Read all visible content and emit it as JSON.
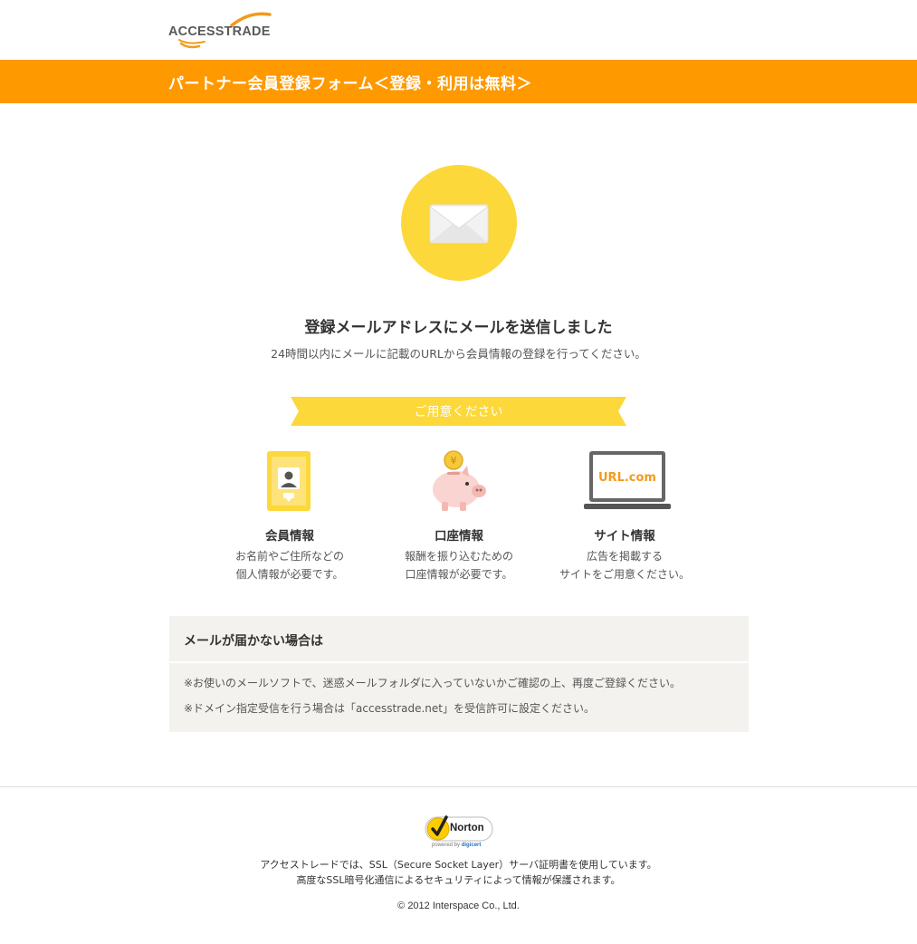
{
  "header": {
    "logo_text": "ACCESSTRADE",
    "banner_title": "パートナー会員登録フォーム＜登録・利用は無料＞"
  },
  "main": {
    "icon": "envelope-icon",
    "headline": "登録メールアドレスにメールを送信しました",
    "subline": "24時間以内にメールに記載のURLから会員情報の登録を行ってください。",
    "ribbon_label": "ご用意ください",
    "features": [
      {
        "icon": "id-card-icon",
        "title": "会員情報",
        "desc1": "お名前やご住所などの",
        "desc2": "個人情報が必要です。"
      },
      {
        "icon": "piggy-bank-icon",
        "title": "口座情報",
        "desc1": "報酬を振り込むための",
        "desc2": "口座情報が必要です。"
      },
      {
        "icon": "laptop-url-icon",
        "title": "サイト情報",
        "desc1": "広告を掲載する",
        "desc2": "サイトをご用意ください。",
        "screen_text": "URL.com"
      }
    ]
  },
  "notice": {
    "title": "メールが届かない場合は",
    "lines": [
      "※お使いのメールソフトで、迷惑メールフォルダに入っていないかご確認の上、再度ご登録ください。",
      "※ドメイン指定受信を行う場合は「accesstrade.net」を受信許可に設定ください。"
    ]
  },
  "footer": {
    "norton_label": "Norton",
    "norton_sub_prefix": "powered by",
    "norton_sub_brand": "digicert",
    "ssl_line1": "アクセストレードでは、SSL（Secure Socket Layer）サーバ証明書を使用しています。",
    "ssl_line2": "高度なSSL暗号化通信によるセキュリティによって情報が保護されます。",
    "copyright": "© 2012 Interspace Co., Ltd."
  },
  "colors": {
    "accent_orange": "#ff9900",
    "accent_yellow": "#fcd83a",
    "notice_bg": "#f3f2ee"
  }
}
